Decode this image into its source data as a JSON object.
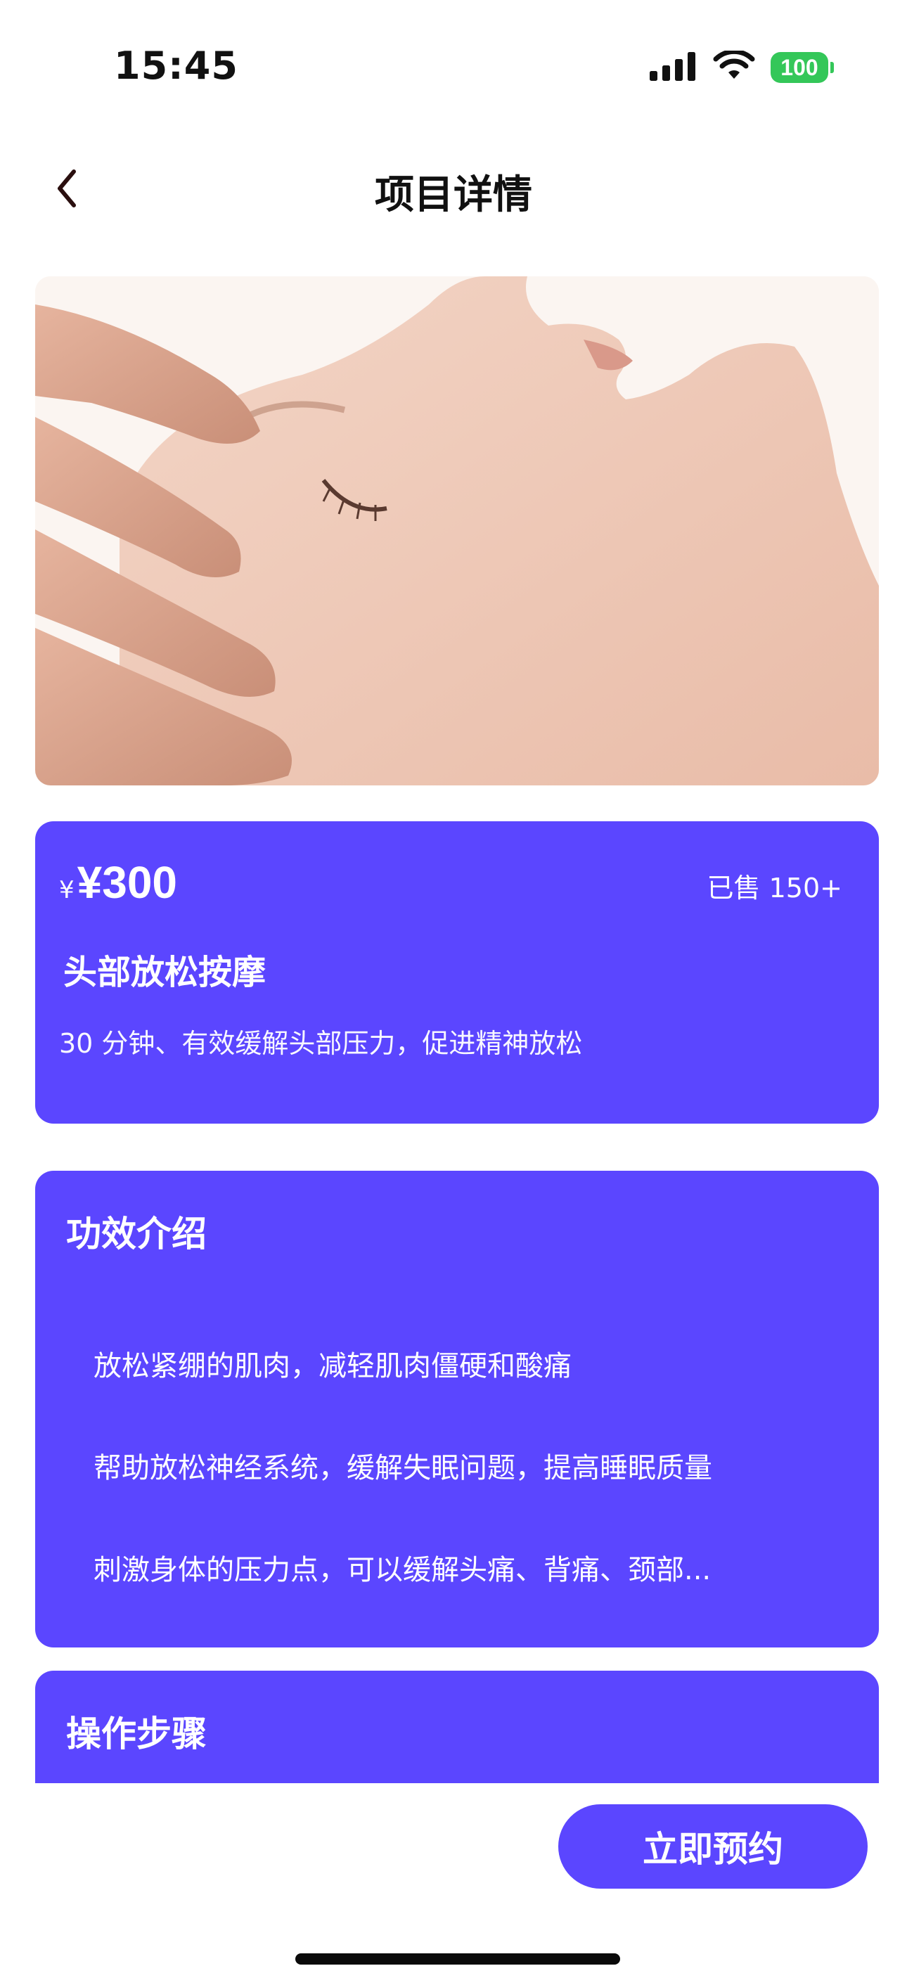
{
  "status_bar": {
    "time": "15:45",
    "battery": "100",
    "icons": [
      "signal-icon",
      "wifi-icon",
      "battery-icon"
    ],
    "battery_color": "#34c759"
  },
  "nav": {
    "title": "项目详情",
    "back_icon": "chevron-left-icon"
  },
  "hero": {
    "image_subject": "face-massage-photo"
  },
  "price_card": {
    "currency_prefix": "¥",
    "price": "¥300",
    "sold": "已售 150+",
    "name": "头部放松按摩",
    "description": "30 分钟、有效缓解头部压力，促进精神放松"
  },
  "effects": {
    "title": "功效介绍",
    "items": [
      "放松紧绷的肌肉，减轻肌肉僵硬和酸痛",
      "帮助放松神经系统，缓解失眠问题，提高睡眠质量",
      "刺激身体的压力点，可以缓解头痛、背痛、颈部..."
    ]
  },
  "steps": {
    "title": "操作步骤"
  },
  "actions": {
    "book_label": "立即预约"
  },
  "colors": {
    "accent": "#5b46ff",
    "card_text": "#ffffff",
    "background": "#ffffff"
  }
}
